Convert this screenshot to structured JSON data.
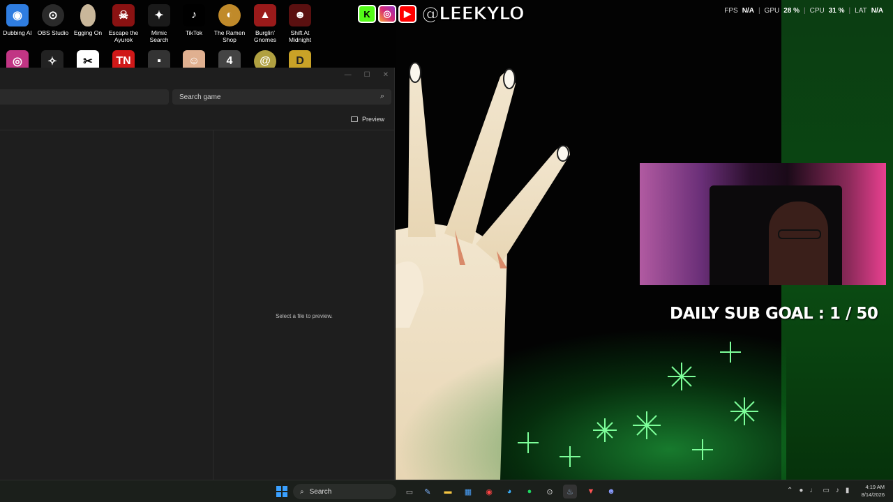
{
  "desktop_icons_row1": [
    {
      "label": "Dubbing AI",
      "icon": "dubbing-ai-icon",
      "color": "#2f7de0"
    },
    {
      "label": "OBS Studio",
      "icon": "obs-icon",
      "color": "#2a2a2a"
    },
    {
      "label": "Egging On",
      "icon": "egg-icon",
      "color": "#c9b79a"
    },
    {
      "label": "Escape the Ayurok",
      "icon": "escape-ayurok-icon",
      "color": "#8a1212"
    },
    {
      "label": "Mimic Search",
      "icon": "mimic-search-icon",
      "color": "#1a1a1a"
    },
    {
      "label": "TikTok",
      "icon": "tiktok-icon",
      "color": "#000000"
    },
    {
      "label": "The Ramen Shop",
      "icon": "ramen-shop-icon",
      "color": "#c08a2a"
    },
    {
      "label": "Burglin' Gnomes",
      "icon": "burglin-gnomes-icon",
      "color": "#9a1a1a"
    },
    {
      "label": "Shift At Midnight",
      "icon": "shift-midnight-icon",
      "color": "#5a1010"
    }
  ],
  "desktop_icons_row2": [
    {
      "icon": "instagram-icon",
      "color": "#c13584"
    },
    {
      "icon": "wolf-icon",
      "color": "#222222"
    },
    {
      "icon": "capcut-icon",
      "color": "#ffffff"
    },
    {
      "icon": "tn-icon",
      "color": "#d01818"
    },
    {
      "icon": "game-icon",
      "color": "#333333"
    },
    {
      "icon": "roblox-avatar-icon",
      "color": "#e0b090"
    },
    {
      "icon": "jump-icon",
      "color": "#444444"
    },
    {
      "icon": "spiral-icon",
      "color": "#b0a040"
    },
    {
      "icon": "d-icon",
      "color": "#c9a227"
    }
  ],
  "banner": {
    "handle": "@LEEKYLO",
    "kick": "K",
    "instagram": "◎",
    "youtube": "▶"
  },
  "perf": {
    "fps_label": "FPS",
    "fps_value": "N/A",
    "gpu_label": "GPU",
    "gpu_value": "28 %",
    "cpu_label": "CPU",
    "cpu_value": "31 %",
    "lat_label": "LAT",
    "lat_value": "N/A"
  },
  "window": {
    "search_placeholder": "Search game",
    "preview_label": "Preview",
    "empty_message": "Select a file to preview."
  },
  "overlay": {
    "sub_goal": "DAILY SUB GOAL : 1 / 50"
  },
  "taskbar": {
    "search_label": "Search",
    "time": "4:19 AM",
    "date": "8/14/2026"
  },
  "colors": {
    "accent_green": "#2ee05a",
    "taskbar_bg": "#1b1f1b",
    "window_bg": "#1e1e1e"
  }
}
